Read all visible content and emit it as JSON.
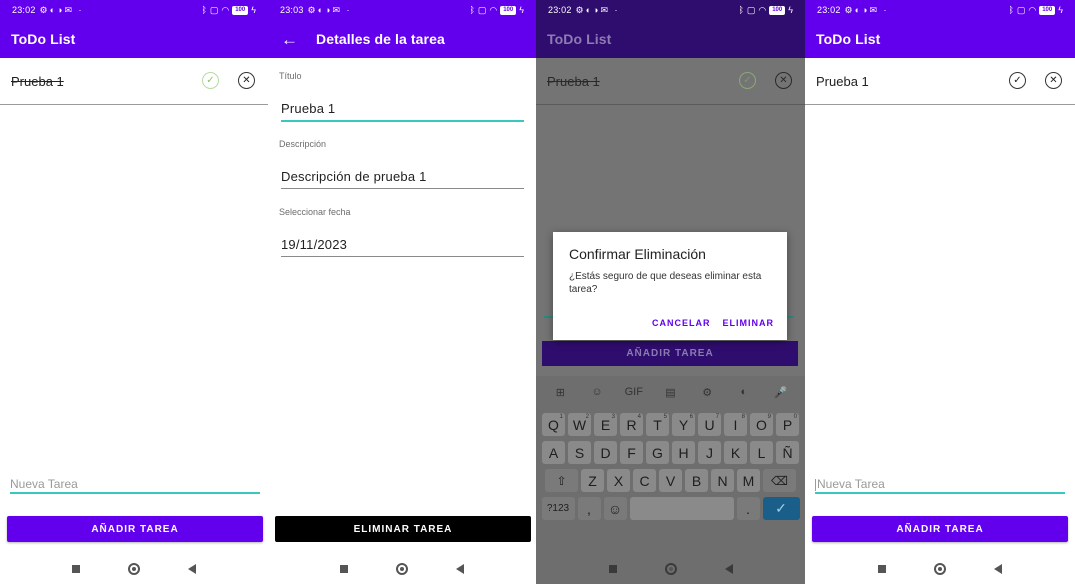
{
  "colors": {
    "primary": "#6200ee",
    "accent": "#39c8bd",
    "danger_button": "#000000"
  },
  "screen1": {
    "status_time": "23:02",
    "battery": "100",
    "app_title": "ToDo List",
    "task": {
      "title": "Prueba 1",
      "completed": true
    },
    "new_task_placeholder": "Nueva Tarea",
    "add_button": "AÑADIR TAREA"
  },
  "screen2": {
    "status_time": "23:03",
    "battery": "100",
    "app_title": "Detalles de la tarea",
    "fields": [
      {
        "label": "Título",
        "value": "Prueba 1"
      },
      {
        "label": "Descripción",
        "value": "Descripción de prueba 1"
      },
      {
        "label": "Seleccionar fecha",
        "value": "19/11/2023"
      }
    ],
    "delete_button": "ELIMINAR TAREA"
  },
  "screen3": {
    "status_time": "23:02",
    "battery": "100",
    "app_title": "ToDo List",
    "task": {
      "title": "Prueba 1",
      "completed": true
    },
    "add_button": "AÑADIR TAREA",
    "dialog": {
      "title": "Confirmar Eliminación",
      "message": "¿Estás seguro de que deseas eliminar esta tarea?",
      "cancel": "CANCELAR",
      "confirm": "ELIMINAR"
    },
    "keyboard": {
      "toolbar": [
        "⊞",
        "☺",
        "GIF",
        "▤",
        "⚙",
        "◐",
        "🎤"
      ],
      "row1": [
        "Q",
        "W",
        "E",
        "R",
        "T",
        "Y",
        "U",
        "I",
        "O",
        "P"
      ],
      "row1_hints": [
        "1",
        "2",
        "3",
        "4",
        "5",
        "6",
        "7",
        "8",
        "9",
        "0"
      ],
      "row2": [
        "A",
        "S",
        "D",
        "F",
        "G",
        "H",
        "J",
        "K",
        "L",
        "Ñ"
      ],
      "row3": [
        "Z",
        "X",
        "C",
        "V",
        "B",
        "N",
        "M"
      ],
      "shift": "⇧",
      "backspace": "⌫",
      "symbols": "?123",
      "comma": ",",
      "emoji": "☺",
      "period": ".",
      "enter": "✓"
    }
  },
  "screen4": {
    "status_time": "23:02",
    "battery": "100",
    "app_title": "ToDo List",
    "task": {
      "title": "Prueba 1",
      "completed": false
    },
    "new_task_placeholder": "Nueva Tarea",
    "add_button": "AÑADIR TAREA"
  }
}
